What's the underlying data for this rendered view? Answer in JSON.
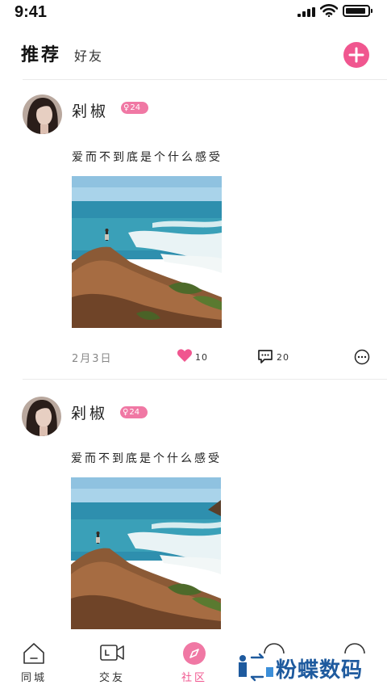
{
  "status_bar": {
    "time": "9:41"
  },
  "header": {
    "tabs": [
      {
        "label": "推荐",
        "active": true
      },
      {
        "label": "好友",
        "active": false
      }
    ]
  },
  "posts": [
    {
      "username": "剁椒",
      "badge": {
        "symbol": "♀",
        "age": "24"
      },
      "text": "爱而不到底是个什么感受",
      "date": "2月3日",
      "likes": "10",
      "comments": "20"
    },
    {
      "username": "剁椒",
      "badge": {
        "symbol": "♀",
        "age": "24"
      },
      "text": "爱而不到底是个什么感受"
    }
  ],
  "tab_bar": {
    "items": [
      {
        "label": "同城",
        "icon": "home-icon",
        "active": false
      },
      {
        "label": "交友",
        "icon": "video-icon",
        "active": false
      },
      {
        "label": "社区",
        "icon": "compass-icon",
        "active": true
      },
      {
        "label": "",
        "icon": "message-icon",
        "active": false
      },
      {
        "label": "",
        "icon": "profile-icon",
        "active": false
      }
    ]
  },
  "watermark": {
    "text": "粉蝶数码"
  },
  "colors": {
    "accent": "#f0568f",
    "badge": "#f078a4",
    "watermark": "#1e5a9e"
  }
}
